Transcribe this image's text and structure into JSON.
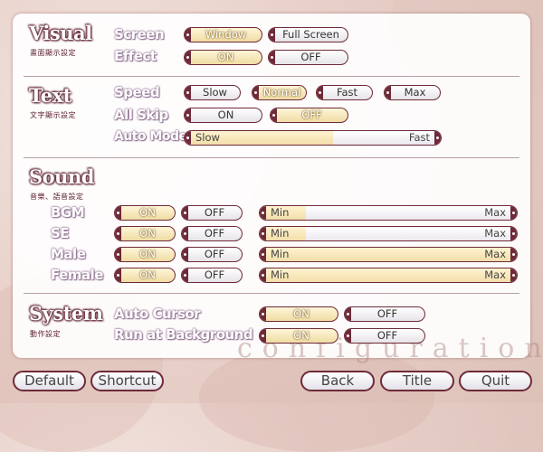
{
  "visual": {
    "title": "Visual",
    "subtitle": "畫面顯示設定",
    "screen": {
      "label": "Screen",
      "options": [
        "Window",
        "Full Screen"
      ],
      "selected": "Window"
    },
    "effect": {
      "label": "Effect",
      "options": [
        "ON",
        "OFF"
      ],
      "selected": "ON"
    }
  },
  "text": {
    "title": "Text",
    "subtitle": "文字顯示設定",
    "speed": {
      "label": "Speed",
      "options": [
        "Slow",
        "Normal",
        "Fast",
        "Max"
      ],
      "selected": "Normal"
    },
    "all_skip": {
      "label": "All Skip",
      "options": [
        "ON",
        "OFF"
      ],
      "selected": "OFF"
    },
    "auto_mode": {
      "label": "Auto Mode",
      "min_label": "Slow",
      "max_label": "Fast",
      "level": 0.58
    }
  },
  "sound": {
    "title": "Sound",
    "subtitle": "音樂、語音設定",
    "bgm": {
      "label": "BGM",
      "options": [
        "ON",
        "OFF"
      ],
      "selected": "ON",
      "min_label": "Min",
      "max_label": "Max",
      "level": 0.18
    },
    "se": {
      "label": "SE",
      "options": [
        "ON",
        "OFF"
      ],
      "selected": "ON",
      "min_label": "Min",
      "max_label": "Max",
      "level": 0.18
    },
    "male": {
      "label": "Male",
      "options": [
        "ON",
        "OFF"
      ],
      "selected": "ON",
      "min_label": "Min",
      "max_label": "Max",
      "level": 1.0
    },
    "female": {
      "label": "Female",
      "options": [
        "ON",
        "OFF"
      ],
      "selected": "ON",
      "min_label": "Min",
      "max_label": "Max",
      "level": 1.0
    }
  },
  "system": {
    "title": "System",
    "subtitle": "動作設定",
    "auto_cursor": {
      "label": "Auto Cursor",
      "options": [
        "ON",
        "OFF"
      ],
      "selected": "ON"
    },
    "run_background": {
      "label": "Run at Background",
      "options": [
        "ON",
        "OFF"
      ],
      "selected": "ON"
    }
  },
  "watermark": "configuration",
  "buttons": {
    "default": "Default",
    "shortcut": "Shortcut",
    "back": "Back",
    "title": "Title",
    "quit": "Quit"
  },
  "colors": {
    "accent": "#6e2a38",
    "selected_fill": "#f0dca4",
    "label_outline": "#8e6f8f"
  }
}
